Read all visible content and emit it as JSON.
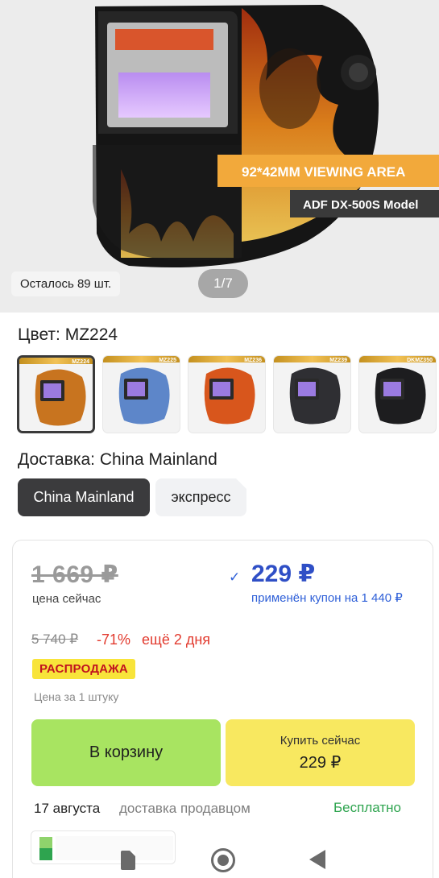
{
  "gallery": {
    "banner_line1": "92*42MM VIEWING AREA",
    "banner_line2": "ADF DX-500S Model",
    "stock_text": "Осталось 89 шт.",
    "pager": "1/7"
  },
  "color": {
    "label": "Цвет: MZ224",
    "selected": "MZ224",
    "swatches": [
      {
        "code": "MZ224",
        "tone": "#c8741f"
      },
      {
        "code": "MZ225",
        "tone": "#5d86c9"
      },
      {
        "code": "MZ236",
        "tone": "#d8561c"
      },
      {
        "code": "MZ239",
        "tone": "#2f2f33"
      },
      {
        "code": "DKMZ350",
        "tone": "#1d1d1f"
      }
    ]
  },
  "delivery": {
    "label": "Доставка: China Mainland",
    "options": [
      "China Mainland",
      "экспресс"
    ]
  },
  "price": {
    "old": "1 669 ₽",
    "now_label": "цена сейчас",
    "coupon_price": "229 ₽",
    "coupon_note": "применён купон на 1 440 ₽",
    "original": "5 740 ₽",
    "discount": "-71%",
    "timer": "ещё 2 дня",
    "sale_badge": "РАСПРОДАЖА",
    "per_unit": "Цена за 1 штуку"
  },
  "actions": {
    "cart": "В корзину",
    "buy_label": "Купить сейчас",
    "buy_price": "229 ₽"
  },
  "shipping": {
    "date": "17 августа",
    "by": "доставка продавцом",
    "cost": "Бесплатно"
  },
  "colors": {
    "accent_blue": "#2f4fc6",
    "sale_red": "#e23a2e",
    "cart_green": "#a8e461",
    "buy_yellow": "#f8e860",
    "free_green": "#2ea44f"
  }
}
